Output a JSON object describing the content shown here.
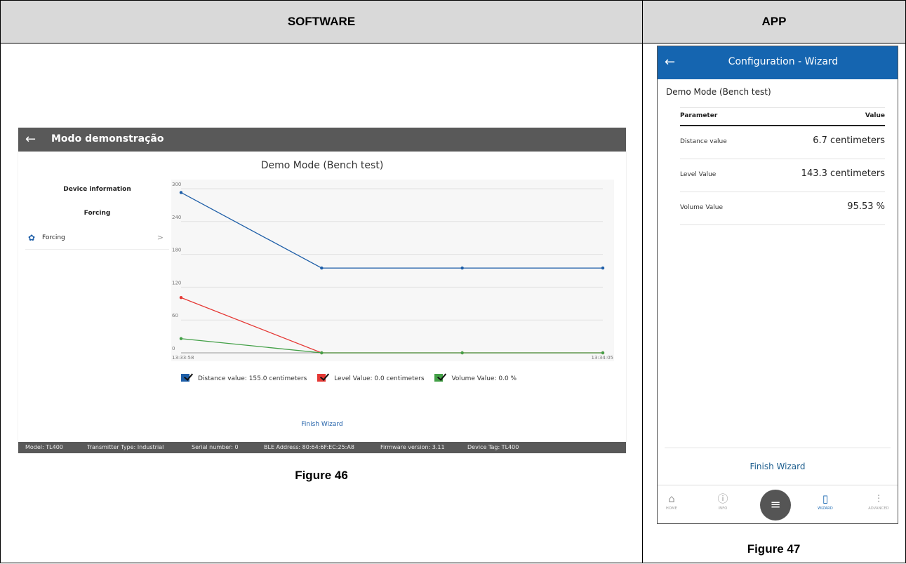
{
  "headers": {
    "software": "SOFTWARE",
    "app": "APP"
  },
  "captions": {
    "left": "Figure 46",
    "right": "Figure 47"
  },
  "software": {
    "back_icon": "arrow-left-icon",
    "title": "Modo demonstração",
    "heading": "Demo Mode (Bench test)",
    "sidebar": {
      "section1": "Device information",
      "section2": "Forcing",
      "item_label": "Forcing",
      "item_icon": "gear-icon"
    },
    "chart_data": {
      "type": "line",
      "x": [
        "13:33:58",
        "",
        "",
        "13:34:05"
      ],
      "x_tick_labels": [
        "13:33:58",
        "13:34:05"
      ],
      "y_ticks": [
        "300",
        "240",
        "180",
        "120",
        "60",
        "0"
      ],
      "ylim": [
        0,
        300
      ],
      "grid": true,
      "series": [
        {
          "name": "Distance value: 155.0 centimeters",
          "color": "#1f5fa8",
          "values": [
            293,
            155,
            155,
            155
          ]
        },
        {
          "name": "Level Value: 0.0 centimeters",
          "color": "#e53935",
          "values": [
            101,
            0,
            0,
            0
          ]
        },
        {
          "name": "Volume Value: 0.0 %",
          "color": "#43a047",
          "values": [
            26,
            0,
            0,
            0
          ]
        }
      ],
      "legend_position": "bottom-left"
    },
    "finish_label": "Finish Wizard",
    "footer": {
      "model": "Model: TL400",
      "transmitter": "Transmitter Type: Industrial",
      "serial": "Serial number: 0",
      "ble": "BLE Address: 80:64:6F:EC:25:A8",
      "firmware": "Firmware version: 3.11",
      "tag": "Device Tag: TL400"
    }
  },
  "app": {
    "title": "Configuration - Wizard",
    "back_icon": "arrow-left-icon",
    "subtitle": "Demo Mode (Bench test)",
    "table": {
      "col_parameter": "Parameter",
      "col_value": "Value",
      "rows": [
        {
          "label": "Distance value",
          "value": "6.7 centimeters"
        },
        {
          "label": "Level Value",
          "value": "143.3 centimeters"
        },
        {
          "label": "Volume Value",
          "value": "95.53 %"
        }
      ]
    },
    "finish_label": "Finish Wizard",
    "nav": {
      "home": "HOME",
      "info": "INFO",
      "wizard": "WIZARD",
      "advanced": "ADVANCED",
      "active": "wizard",
      "active_color": "#1565b0"
    }
  }
}
